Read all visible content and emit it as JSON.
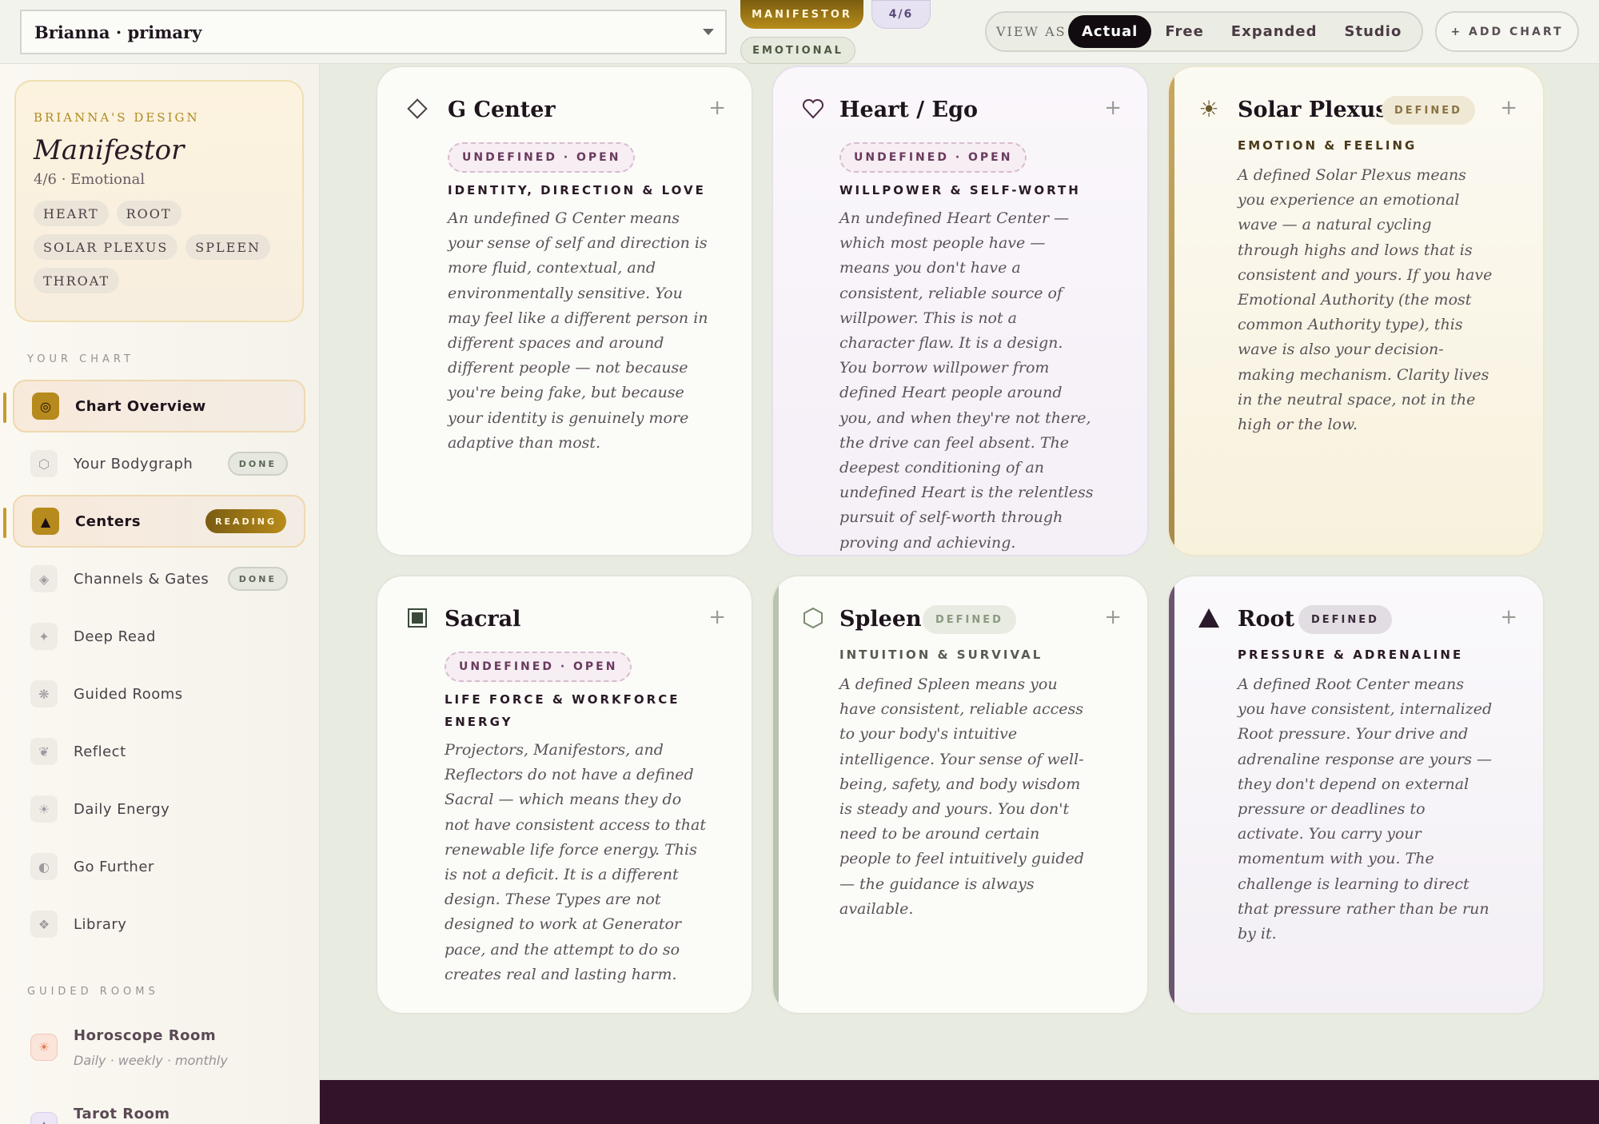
{
  "header": {
    "chart_select": "Brianna · primary",
    "type_pill": "MANIFESTOR",
    "profile_pill": "4/6",
    "authority_pill": "EMOTIONAL",
    "view_as_label": "VIEW AS",
    "view_options": [
      "Actual",
      "Free",
      "Expanded",
      "Studio"
    ],
    "view_active": "Actual",
    "add_chart": "+ ADD CHART"
  },
  "sidebar": {
    "design": {
      "eyebrow": "BRIANNA'S DESIGN",
      "title": "Manifestor",
      "subtitle": "4/6 · Emotional",
      "chips": [
        "HEART",
        "ROOT",
        "SOLAR PLEXUS",
        "SPLEEN",
        "THROAT"
      ]
    },
    "section_chart": "YOUR CHART",
    "nav": [
      {
        "label": "Chart Overview",
        "icon": "◎",
        "badge": ""
      },
      {
        "label": "Your Bodygraph",
        "icon": "⬡",
        "badge": "DONE"
      },
      {
        "label": "Centers",
        "icon": "▲",
        "badge": "READING"
      },
      {
        "label": "Channels & Gates",
        "icon": "◈",
        "badge": "DONE"
      },
      {
        "label": "Deep Read",
        "icon": "✦",
        "badge": ""
      },
      {
        "label": "Guided Rooms",
        "icon": "❋",
        "badge": ""
      },
      {
        "label": "Reflect",
        "icon": "❦",
        "badge": ""
      },
      {
        "label": "Daily Energy",
        "icon": "☀",
        "badge": ""
      },
      {
        "label": "Go Further",
        "icon": "◐",
        "badge": ""
      },
      {
        "label": "Library",
        "icon": "❖",
        "badge": ""
      }
    ],
    "section_rooms": "GUIDED ROOMS",
    "rooms": [
      {
        "title": "Horoscope Room",
        "subtitle": "Daily · weekly · monthly",
        "icon": "☀"
      },
      {
        "title": "Tarot Room",
        "subtitle": "",
        "icon": "✦"
      }
    ]
  },
  "cards": [
    {
      "name": "G Center",
      "icon": "diamond-icon",
      "state": "UNDEFINED · OPEN",
      "subtitle": "IDENTITY, DIRECTION & LOVE",
      "body": "An undefined G Center means your sense of self and direction is more fluid, contextual, and environmentally sensitive. You may feel like a different person in different spaces and around different people — not because you're being fake, but because your identity is genuinely more adaptive than most."
    },
    {
      "name": "Heart / Ego",
      "icon": "heart-icon",
      "state": "UNDEFINED · OPEN",
      "subtitle": "WILLPOWER & SELF-WORTH",
      "body": "An undefined Heart Center — which most people have — means you don't have a consistent, reliable source of willpower. This is not a character flaw. It is a design. You borrow willpower from defined Heart people around you, and when they're not there, the drive can feel absent. The deepest conditioning of an undefined Heart is the relentless pursuit of self-worth through proving and achieving."
    },
    {
      "name": "Solar Plexus",
      "icon": "sun-icon",
      "state": "DEFINED",
      "subtitle": "EMOTION & FEELING",
      "body": "A defined Solar Plexus means you experience an emotional wave — a natural cycling through highs and lows that is consistent and yours. If you have Emotional Authority (the most common Authority type), this wave is also your decision-making mechanism. Clarity lives in the neutral space, not in the high or the low."
    },
    {
      "name": "Sacral",
      "icon": "square-icon",
      "state": "UNDEFINED · OPEN",
      "subtitle": "LIFE FORCE & WORKFORCE ENERGY",
      "body": "Projectors, Manifestors, and Reflectors do not have a defined Sacral — which means they do not have consistent access to that renewable life force energy. This is not a deficit. It is a different design. These Types are not designed to work at Generator pace, and the attempt to do so creates real and lasting harm."
    },
    {
      "name": "Spleen",
      "icon": "hexagon-icon",
      "state": "DEFINED",
      "subtitle": "INTUITION & SURVIVAL",
      "body": "A defined Spleen means you have consistent, reliable access to your body's intuitive intelligence. Your sense of well-being, safety, and body wisdom is steady and yours. You don't need to be around certain people to feel intuitively guided — the guidance is always available."
    },
    {
      "name": "Root",
      "icon": "triangle-icon",
      "state": "DEFINED",
      "subtitle": "PRESSURE & ADRENALINE",
      "body": "A defined Root Center means you have consistent, internalized Root pressure. Your drive and adrenaline response are yours — they don't depend on external pressure or deadlines to activate. You carry your momentum with you. The challenge is learning to direct that pressure rather than be run by it."
    }
  ],
  "card_plus": "+"
}
